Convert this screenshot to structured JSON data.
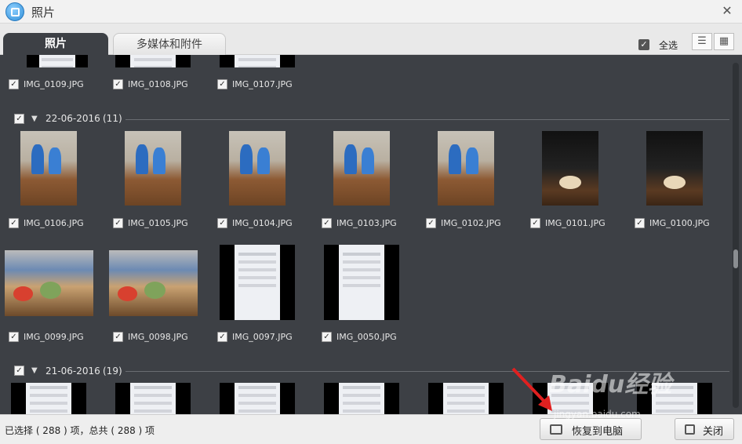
{
  "window": {
    "title": "照片"
  },
  "tabs": [
    {
      "label": "照片"
    },
    {
      "label": "多媒体和附件"
    }
  ],
  "toolbar": {
    "select_all_label": "全选",
    "check_mark": "✓",
    "list_view_glyph": "☰",
    "calendar_view_glyph": "▦"
  },
  "groups": [
    {
      "header": null,
      "items": [
        {
          "name": "IMG_0109.JPG"
        },
        {
          "name": "IMG_0108.JPG"
        },
        {
          "name": "IMG_0107.JPG"
        }
      ]
    },
    {
      "date": "22-06-2016",
      "count": "(11)",
      "items": [
        {
          "name": "IMG_0106.JPG"
        },
        {
          "name": "IMG_0105.JPG"
        },
        {
          "name": "IMG_0104.JPG"
        },
        {
          "name": "IMG_0103.JPG"
        },
        {
          "name": "IMG_0102.JPG"
        },
        {
          "name": "IMG_0101.JPG"
        },
        {
          "name": "IMG_0100.JPG"
        },
        {
          "name": "IMG_0099.JPG"
        },
        {
          "name": "IMG_0098.JPG"
        },
        {
          "name": "IMG_0097.JPG"
        },
        {
          "name": "IMG_0050.JPG"
        }
      ]
    },
    {
      "date": "21-06-2016",
      "count": "(19)"
    }
  ],
  "status": {
    "text": "已选择 ( 288 ) 项，总共 ( 288 ) 项"
  },
  "buttons": {
    "restore": "恢复到电脑",
    "close": "关闭"
  },
  "watermark": {
    "main": "Baidu经验",
    "sub": "jingyan.baidu.com"
  },
  "colors": {
    "content_bg": "#3d4045",
    "arrow": "#e02020"
  }
}
